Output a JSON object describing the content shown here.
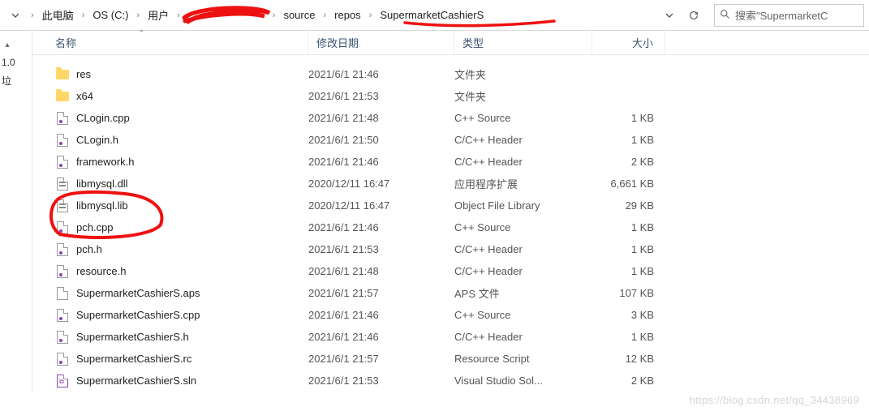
{
  "breadcrumb": {
    "items": [
      "此电脑",
      "OS (C:)",
      "用户",
      "",
      "source",
      "repos",
      "SupermarketCashierS"
    ]
  },
  "search": {
    "placeholder": "搜索\"SupermarketC"
  },
  "leftpanel": {
    "r0": "",
    "r1": "1.0",
    "r2": "垃"
  },
  "columns": {
    "name": "名称",
    "date": "修改日期",
    "type": "类型",
    "size": "大小"
  },
  "files": [
    {
      "icon": "folder",
      "name": "res",
      "date": "2021/6/1 21:46",
      "type": "文件夹",
      "size": ""
    },
    {
      "icon": "folder",
      "name": "x64",
      "date": "2021/6/1 21:53",
      "type": "文件夹",
      "size": ""
    },
    {
      "icon": "cpp",
      "name": "CLogin.cpp",
      "date": "2021/6/1 21:48",
      "type": "C++ Source",
      "size": "1 KB"
    },
    {
      "icon": "h",
      "name": "CLogin.h",
      "date": "2021/6/1 21:50",
      "type": "C/C++ Header",
      "size": "1 KB"
    },
    {
      "icon": "h",
      "name": "framework.h",
      "date": "2021/6/1 21:46",
      "type": "C/C++ Header",
      "size": "2 KB"
    },
    {
      "icon": "dll",
      "name": "libmysql.dll",
      "date": "2020/12/11 16:47",
      "type": "应用程序扩展",
      "size": "6,661 KB"
    },
    {
      "icon": "lib",
      "name": "libmysql.lib",
      "date": "2020/12/11 16:47",
      "type": "Object File Library",
      "size": "29 KB"
    },
    {
      "icon": "cpp",
      "name": "pch.cpp",
      "date": "2021/6/1 21:46",
      "type": "C++ Source",
      "size": "1 KB"
    },
    {
      "icon": "h",
      "name": "pch.h",
      "date": "2021/6/1 21:53",
      "type": "C/C++ Header",
      "size": "1 KB"
    },
    {
      "icon": "h",
      "name": "resource.h",
      "date": "2021/6/1 21:48",
      "type": "C/C++ Header",
      "size": "1 KB"
    },
    {
      "icon": "file",
      "name": "SupermarketCashierS.aps",
      "date": "2021/6/1 21:57",
      "type": "APS 文件",
      "size": "107 KB"
    },
    {
      "icon": "cpp",
      "name": "SupermarketCashierS.cpp",
      "date": "2021/6/1 21:46",
      "type": "C++ Source",
      "size": "3 KB"
    },
    {
      "icon": "h",
      "name": "SupermarketCashierS.h",
      "date": "2021/6/1 21:46",
      "type": "C/C++ Header",
      "size": "1 KB"
    },
    {
      "icon": "rc",
      "name": "SupermarketCashierS.rc",
      "date": "2021/6/1 21:57",
      "type": "Resource Script",
      "size": "12 KB"
    },
    {
      "icon": "sln",
      "name": "SupermarketCashierS.sln",
      "date": "2021/6/1 21:53",
      "type": "Visual Studio Sol...",
      "size": "2 KB"
    }
  ],
  "watermark": "https://blog.csdn.net/qq_34438969"
}
